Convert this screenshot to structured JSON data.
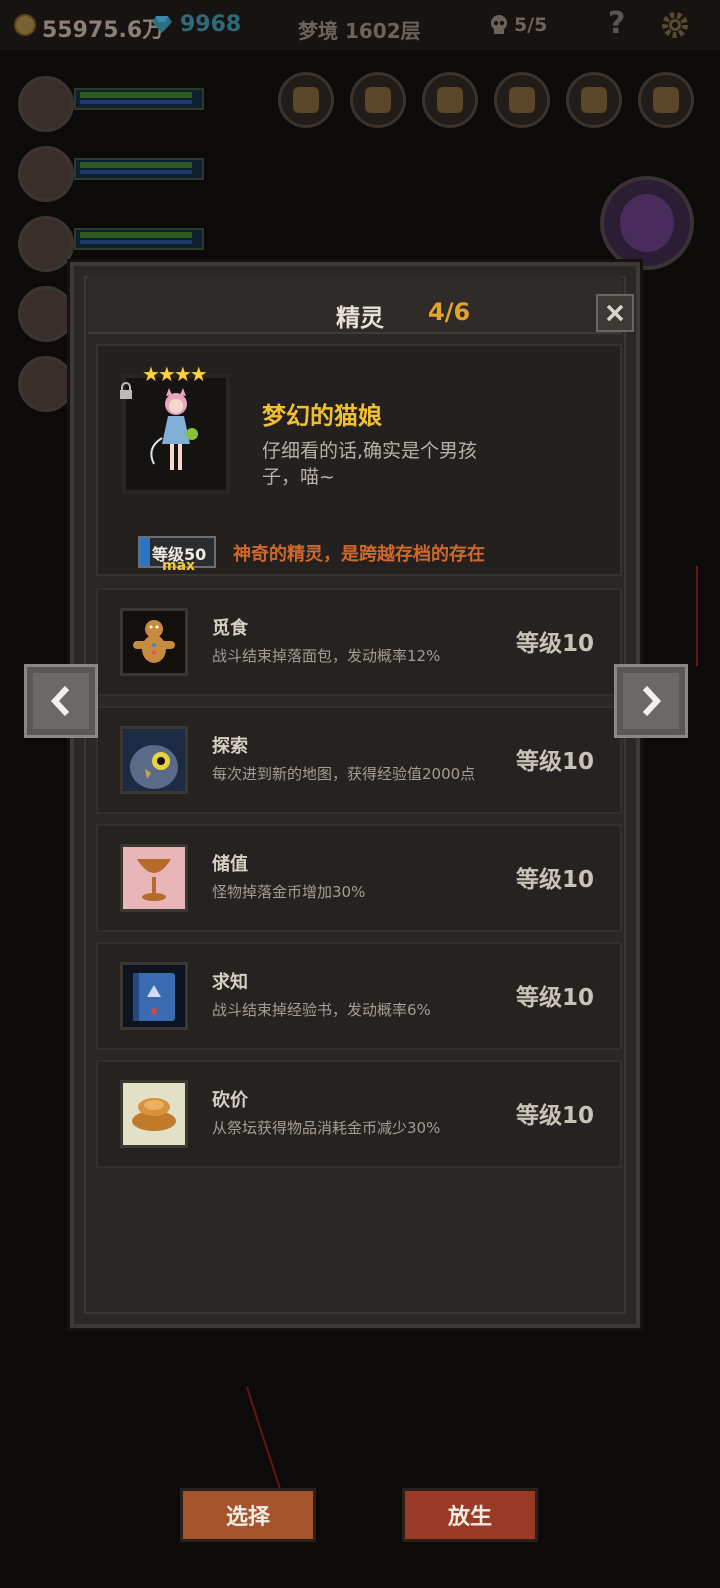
{
  "topbar": {
    "gold": "55975.6万",
    "gems": "9968",
    "floor": "梦境 1602层",
    "lives": "5/5",
    "help": "?"
  },
  "dialog": {
    "title": "精灵",
    "count": "4/6"
  },
  "spirit": {
    "stars": "★★★★",
    "name": "梦幻的猫娘",
    "description": "仔细看的话,确实是个男孩子，喵~",
    "level": "等级50",
    "max_label": "max",
    "note": "神奇的精灵，是跨越存档的存在"
  },
  "skills": [
    {
      "name": "觅食",
      "description": "战斗结束掉落面包，发动概率12%",
      "level": "等级10",
      "icon": "gingerbread-icon"
    },
    {
      "name": "探索",
      "description": "每次进到新的地图，获得经验值2000点",
      "level": "等级10",
      "icon": "owl-icon"
    },
    {
      "name": "储值",
      "description": "怪物掉落金币增加30%",
      "level": "等级10",
      "icon": "goblet-icon"
    },
    {
      "name": "求知",
      "description": "战斗结束掉经验书，发动概率6%",
      "level": "等级10",
      "icon": "book-icon"
    },
    {
      "name": "砍价",
      "description": "从祭坛获得物品消耗金币减少30%",
      "level": "等级10",
      "icon": "coins-icon"
    }
  ],
  "buttons": {
    "select": "选择",
    "release": "放生"
  },
  "colors": {
    "accent_gold": "#f0c030",
    "count_orange": "#e6a32a",
    "note_orange": "#d0672b",
    "button_red": "#9a3a26"
  }
}
